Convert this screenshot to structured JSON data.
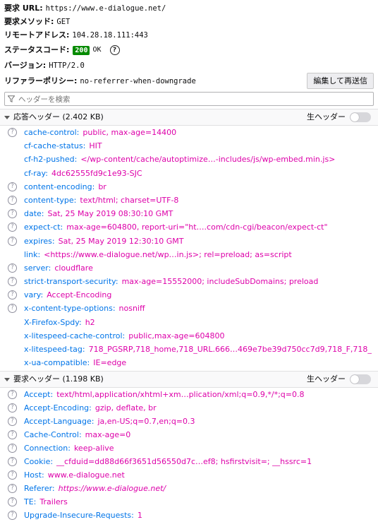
{
  "summary": {
    "url_label": "要求 URL:",
    "url_value": "https://www.e-dialogue.net/",
    "method_label": "要求メソッド:",
    "method_value": "GET",
    "remote_label": "リモートアドレス:",
    "remote_value": "104.28.18.111:443",
    "status_label": "ステータスコード:",
    "status_code": "200",
    "status_text": "OK",
    "version_label": "バージョン:",
    "version_value": "HTTP/2.0",
    "referrer_label": "リファラーポリシー:",
    "referrer_value": "no-referrer-when-downgrade",
    "resend_label": "編集して再送信"
  },
  "filter": {
    "placeholder": "ヘッダーを検索",
    "icon": "funnel-icon"
  },
  "response": {
    "title": "応答ヘッダー (2.402 KB)",
    "raw_label": "生ヘッダー",
    "raw_enabled": false,
    "headers": [
      {
        "name": "cache-control:",
        "value": "public, max-age=14400",
        "help": true
      },
      {
        "name": "cf-cache-status:",
        "value": "HIT",
        "help": false
      },
      {
        "name": "cf-h2-pushed:",
        "value": "</wp-content/cache/autoptimize…-includes/js/wp-embed.min.js>",
        "help": false
      },
      {
        "name": "cf-ray:",
        "value": "4dc62555fd9c1e93-SJC",
        "help": false
      },
      {
        "name": "content-encoding:",
        "value": "br",
        "help": true
      },
      {
        "name": "content-type:",
        "value": "text/html; charset=UTF-8",
        "help": true
      },
      {
        "name": "date:",
        "value": "Sat, 25 May 2019 08:30:10 GMT",
        "help": true
      },
      {
        "name": "expect-ct:",
        "value": "max-age=604800, report-uri=\"ht….com/cdn-cgi/beacon/expect-ct\"",
        "help": true
      },
      {
        "name": "expires:",
        "value": "Sat, 25 May 2019 12:30:10 GMT",
        "help": true
      },
      {
        "name": "link:",
        "value": "<https://www.e-dialogue.net/wp…in.js>; rel=preload; as=script",
        "help": false
      },
      {
        "name": "server:",
        "value": "cloudflare",
        "help": true
      },
      {
        "name": "strict-transport-security:",
        "value": "max-age=15552000; includeSubDomains; preload",
        "help": true
      },
      {
        "name": "vary:",
        "value": "Accept-Encoding",
        "help": true
      },
      {
        "name": "x-content-type-options:",
        "value": "nosniff",
        "help": true
      },
      {
        "name": "X-Firefox-Spdy:",
        "value": "h2",
        "help": false
      },
      {
        "name": "x-litespeed-cache-control:",
        "value": "public,max-age=604800",
        "help": false
      },
      {
        "name": "x-litespeed-tag:",
        "value": "718_PGSRP,718_home,718_URL.666…469e7be39d750cc7d9,718_F,718_",
        "help": false
      },
      {
        "name": "x-ua-compatible:",
        "value": "IE=edge",
        "help": false
      }
    ]
  },
  "request": {
    "title": "要求ヘッダー (1.198 KB)",
    "raw_label": "生ヘッダー",
    "raw_enabled": false,
    "headers": [
      {
        "name": "Accept:",
        "value": "text/html,application/xhtml+xm…plication/xml;q=0.9,*/*;q=0.8",
        "help": true
      },
      {
        "name": "Accept-Encoding:",
        "value": "gzip, deflate, br",
        "help": true
      },
      {
        "name": "Accept-Language:",
        "value": "ja,en-US;q=0.7,en;q=0.3",
        "help": true
      },
      {
        "name": "Cache-Control:",
        "value": "max-age=0",
        "help": true
      },
      {
        "name": "Connection:",
        "value": "keep-alive",
        "help": true
      },
      {
        "name": "Cookie:",
        "value": "__cfduid=dd88d66f3651d56550d7c…ef8; hsfirstvisit=; __hssrc=1",
        "help": true
      },
      {
        "name": "Host:",
        "value": "www.e-dialogue.net",
        "help": true
      },
      {
        "name": "Referer:",
        "value": "https://www.e-dialogue.net/",
        "help": true,
        "italic": true
      },
      {
        "name": "TE:",
        "value": "Trailers",
        "help": true
      },
      {
        "name": "Upgrade-Insecure-Requests:",
        "value": "1",
        "help": true
      }
    ]
  }
}
